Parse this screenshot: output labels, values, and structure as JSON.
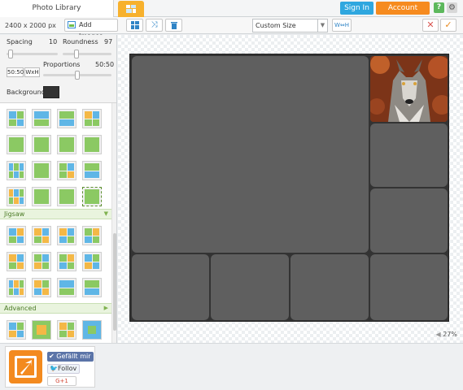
{
  "topbar": {
    "library_tab": "Photo Library",
    "collage_tab_icon": "collage-grid-icon",
    "sign_in": "Sign In",
    "account": "Account",
    "help": "?",
    "settings_icon": "gear-icon"
  },
  "toolbar": {
    "canvas_size": "2400 x 2000 px",
    "add_images": "Add Images",
    "layout_icon": "grid-layout-icon",
    "shuffle_icon": "shuffle-icon",
    "delete_icon": "trash-icon",
    "size_select": "Custom Size",
    "wh_button": "W⇔H",
    "cancel": "✕",
    "confirm": "✓"
  },
  "settings": {
    "spacing_label": "Spacing",
    "spacing_value": "10",
    "roundness_label": "Roundness",
    "roundness_value": "97",
    "proportions_label": "Proportions",
    "proportions_value": "50:50",
    "ratio_button": "50:50",
    "wxh_button": "WxH",
    "background_label": "Background",
    "background_color": "#333333"
  },
  "sections": {
    "jigsaw": "Jigsaw",
    "advanced": "Advanced"
  },
  "workspace": {
    "zoom": "27%"
  },
  "footer": {
    "like": "✔ Gefällt mir",
    "follow": "Follov",
    "gplus": "G+1"
  },
  "colors": {
    "accent_orange": "#f68b1f",
    "accent_blue": "#2fa7df",
    "collage_bg": "#333333",
    "cell": "#5f5f5f"
  }
}
